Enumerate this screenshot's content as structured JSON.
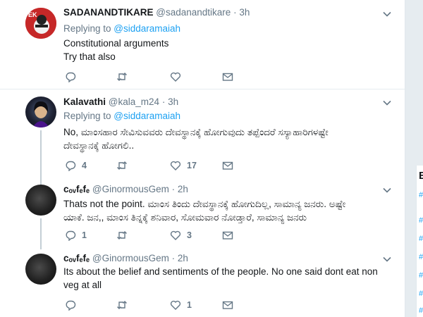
{
  "tweets": [
    {
      "name": "SADANANDTIKARE",
      "handle": "@sadanandtikare",
      "dot": "·",
      "time": "3h",
      "replying_prefix": "Replying to ",
      "replying_to": "@siddaramaiah",
      "lines": [
        "Constitutional arguments",
        "Try that also"
      ],
      "reply_count": "",
      "retweet_count": "",
      "like_count": ""
    },
    {
      "name": "Kalavathi",
      "handle": "@kala_m24",
      "dot": "·",
      "time": "3h",
      "replying_prefix": "Replying to ",
      "replying_to": "@siddaramaiah",
      "lines": [
        "No, ಮಾಂಸಹಾರ ಸೇವಿಸುವವರು ದೇವಸ್ಥಾನಕ್ಕೆ ಹೋಗುವುದು ತಪ್ಪೆಂದರೆ ಸಸ್ಯಾಹಾರಿಗಳಷ್ಟೇ",
        "ದೇವಸ್ಥಾನಕ್ಕೆ ಹೋಗಲಿ.."
      ],
      "reply_count": "4",
      "retweet_count": "",
      "like_count": "17"
    },
    {
      "name": "cₒᵥfₑfₑ",
      "handle": "@GinormousGem",
      "dot": "·",
      "time": "2h",
      "lines": [
        "Thats not the point. ಮಾಂಸ ತಿಂದು ದೇವಸ್ಥಾನಕ್ಕೆ ಹೋಗುದಿಲ್ಲ, ಸಾಮಾನ್ಯ ಜನರು. ಅಷ್ಟೇ",
        "ಯಾಕೆ. ಜನ,, ಮಾಂಸ ತಿನ್ನಕ್ಕೆ ಶನಿವಾರ, ಸೋಮವಾರ ನೋಡ್ತಾರೆ, ಸಾಮಾನ್ಯ ಜನರು"
      ],
      "reply_count": "1",
      "retweet_count": "",
      "like_count": "3"
    },
    {
      "name": "cₒᵥfₑfₑ",
      "handle": "@GinormousGem",
      "dot": "·",
      "time": "2h",
      "lines": [
        "Its about the belief and sentiments of the people. No one said dont eat non",
        "veg at all"
      ],
      "reply_count": "",
      "retweet_count": "",
      "like_count": "1"
    }
  ],
  "avatar_text": {
    "ek": "EK"
  },
  "side_card_chars": [
    "E",
    "#",
    "#",
    "#",
    "#",
    "#",
    "#",
    "#"
  ],
  "colors": {
    "link": "#1da1f2",
    "muted": "#657786",
    "text": "#14171a",
    "divider": "#e6ecf0"
  },
  "icons": [
    "reply-icon",
    "retweet-icon",
    "like-icon",
    "message-icon",
    "chevron-down-icon"
  ]
}
